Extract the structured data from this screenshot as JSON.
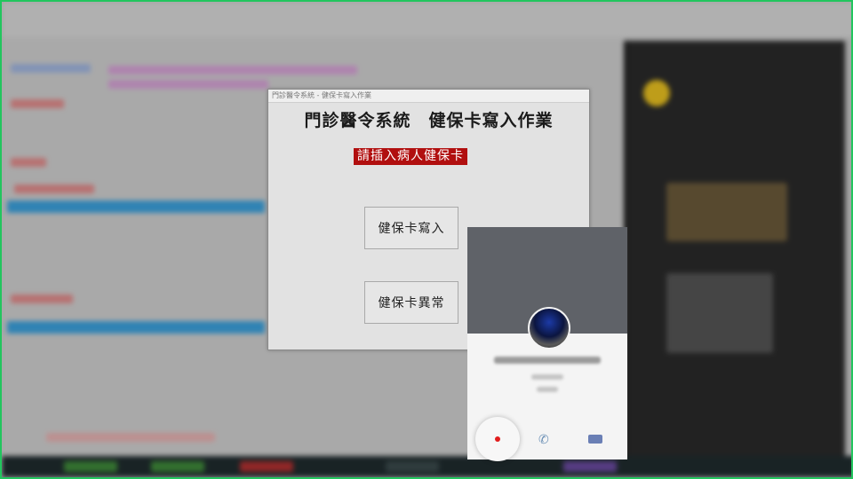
{
  "dialog": {
    "title_bar": "門診醫令系統 - 健保卡寫入作業",
    "heading": "門診醫令系統　健保卡寫入作業",
    "alert": "請插入病人健保卡",
    "write_button": "健保卡寫入",
    "error_button": "健保卡異常"
  },
  "colors": {
    "alert_bg": "#b10f0f",
    "frame_border": "#22c55e",
    "record_dot": "#e11d1d"
  },
  "icons": {
    "call_phone": "phone-icon",
    "call_video": "video-icon",
    "record": "record-icon"
  }
}
